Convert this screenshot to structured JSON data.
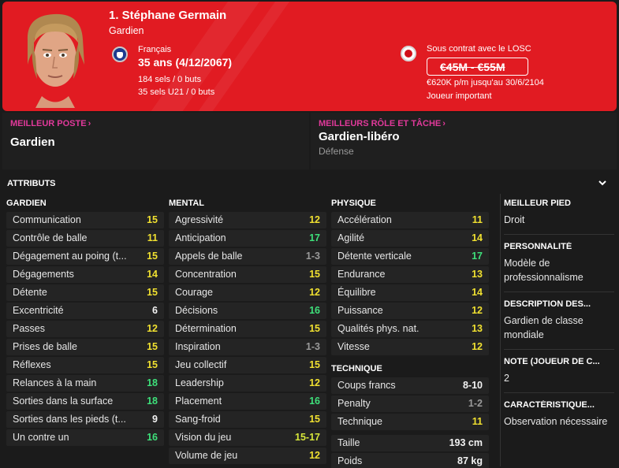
{
  "header": {
    "name": "1. Stéphane Germain",
    "position": "Gardien",
    "nationality": "Français",
    "age": "35 ans (4/12/2067)",
    "caps": "184 sels / 0 buts",
    "caps_u21": "35 sels U21 / 0 buts",
    "contract": "Sous contrat avec le LOSC",
    "value": "€45M - €55M",
    "wage": "€620K p/m jusqu'au 30/6/2104",
    "status": "Joueur important",
    "colors": {
      "accent": "#e11b22",
      "panel_title": "#e0399a"
    }
  },
  "best_position": {
    "title": "MEILLEUR POSTE",
    "value": "Gardien"
  },
  "best_role": {
    "title": "MEILLEURS RÔLE ET TÂCHE",
    "value": "Gardien-libéro",
    "sub": "Défense"
  },
  "attributes": {
    "title": "ATTRIBUTS",
    "gardien": {
      "title": "GARDIEN",
      "rows": [
        {
          "name": "Communication",
          "value": "15"
        },
        {
          "name": "Contrôle de balle",
          "value": "11"
        },
        {
          "name": "Dégagement au poing (t...",
          "value": "15"
        },
        {
          "name": "Dégagements",
          "value": "14"
        },
        {
          "name": "Détente",
          "value": "15"
        },
        {
          "name": "Excentricité",
          "value": "6"
        },
        {
          "name": "Passes",
          "value": "12"
        },
        {
          "name": "Prises de balle",
          "value": "15"
        },
        {
          "name": "Réflexes",
          "value": "15"
        },
        {
          "name": "Relances à la main",
          "value": "18"
        },
        {
          "name": "Sorties dans la surface",
          "value": "18"
        },
        {
          "name": "Sorties dans les pieds (t...",
          "value": "9"
        },
        {
          "name": "Un contre un",
          "value": "16"
        }
      ]
    },
    "mental": {
      "title": "MENTAL",
      "rows": [
        {
          "name": "Agressivité",
          "value": "12"
        },
        {
          "name": "Anticipation",
          "value": "17"
        },
        {
          "name": "Appels de balle",
          "value": "1-3"
        },
        {
          "name": "Concentration",
          "value": "15"
        },
        {
          "name": "Courage",
          "value": "12"
        },
        {
          "name": "Décisions",
          "value": "16"
        },
        {
          "name": "Détermination",
          "value": "15"
        },
        {
          "name": "Inspiration",
          "value": "1-3"
        },
        {
          "name": "Jeu collectif",
          "value": "15"
        },
        {
          "name": "Leadership",
          "value": "12"
        },
        {
          "name": "Placement",
          "value": "16"
        },
        {
          "name": "Sang-froid",
          "value": "15"
        },
        {
          "name": "Vision du jeu",
          "value": "15-17"
        },
        {
          "name": "Volume de jeu",
          "value": "12"
        }
      ]
    },
    "physique": {
      "title": "PHYSIQUE",
      "rows": [
        {
          "name": "Accélération",
          "value": "11"
        },
        {
          "name": "Agilité",
          "value": "14"
        },
        {
          "name": "Détente verticale",
          "value": "17"
        },
        {
          "name": "Endurance",
          "value": "13"
        },
        {
          "name": "Équilibre",
          "value": "14"
        },
        {
          "name": "Puissance",
          "value": "12"
        },
        {
          "name": "Qualités phys. nat.",
          "value": "13"
        },
        {
          "name": "Vitesse",
          "value": "12"
        }
      ]
    },
    "technique": {
      "title": "TECHNIQUE",
      "rows": [
        {
          "name": "Coups francs",
          "value": "8-10"
        },
        {
          "name": "Penalty",
          "value": "1-2"
        },
        {
          "name": "Technique",
          "value": "11"
        }
      ]
    },
    "body": [
      {
        "name": "Taille",
        "value": "193 cm"
      },
      {
        "name": "Poids",
        "value": "87 kg"
      }
    ]
  },
  "side": {
    "foot_title": "MEILLEUR PIED",
    "foot": "Droit",
    "personality_title": "PERSONNALITÉ",
    "personality": "Modèle de professionnalisme",
    "description_title": "DESCRIPTION DES...",
    "description": "Gardien de classe mondiale",
    "rating_title": "NOTE (JOUEUR DE C...",
    "rating": "2",
    "trait_title": "CARACTÉRISTIQUE...",
    "trait": "Observation nécessaire"
  }
}
